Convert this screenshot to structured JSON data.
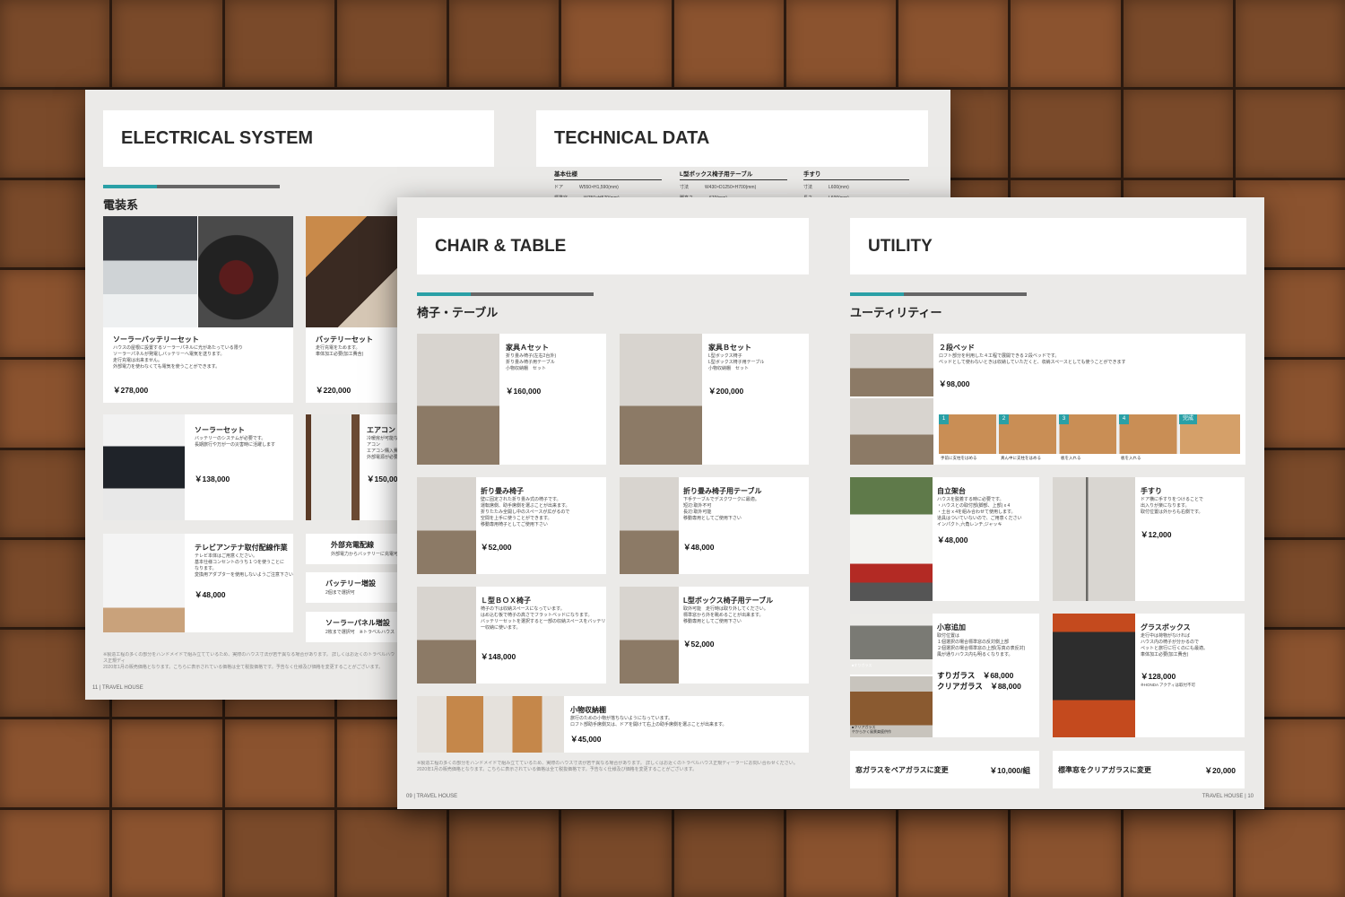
{
  "colors": {
    "accent": "#2aa0a6",
    "page": "#ebeae8",
    "wood": "#6b3f24"
  },
  "back": {
    "electrical": {
      "title": "ELECTRICAL SYSTEM",
      "section": "電装系",
      "items": [
        {
          "name": "ソーラーバッテリーセット",
          "desc": "ハウスの屋根に設置するソーラーパネルに光があたっている限り\nソーラーパネルが発電しバッテリーへ電気を送ります。\n走行充電は出来ません。\n外部電力を使わなくても電気を使うことができます。",
          "price": "￥278,000"
        },
        {
          "name": "バッテリーセット",
          "desc": "走行充電をためます。\n車体加工必要(加工費含)",
          "price": "￥220,000"
        },
        {
          "name": "ソーラーセット",
          "desc": "バッテリーのシステムが必要です。\n長期旅行や万が一の災害時に活躍します",
          "price": "￥138,000"
        },
        {
          "name": "エアコン",
          "desc": "冷暖房が可能なエアコン\nエアコン購入費\n外部電源が必要",
          "price": "￥150,00"
        },
        {
          "name": "テレビアンテナ取付配線作業",
          "desc": "テレビ本体はご用意ください。\n基本仕様コンセントのうち１つを使うことに\nなります。\n変換用アダプターを使用しないようご注意下さい",
          "price": "￥48,000"
        },
        {
          "name": "外部充電配線",
          "desc": "外部電力からバッテリーに充電可能"
        },
        {
          "name": "バッテリー増設",
          "desc": "2個まで選択可"
        },
        {
          "name": "ソーラーパネル増設",
          "desc": "2枚まで選択可　※トラベルハウス"
        }
      ],
      "note": "※製造工程の多くの部分をハンドメイドで組み立てているため、実際のハウス寸法が若干異なる場合があります。 詳しくはお近くのトラベルハウス正規ディ\n2020年1月の販売価格となります。こちらに表示されている価格は全て税抜価格です。予告なく仕様及び価格を変更することがございます。",
      "footer": "11 | TRAVEL HOUSE"
    },
    "technical": {
      "title": "TECHNICAL DATA",
      "columns": [
        {
          "head": "基本仕様",
          "rows": [
            [
              "ドア",
              "W550×H1,590(mm)"
            ],
            [
              "標準窓",
              "W750×H570(mm)"
            ]
          ]
        },
        {
          "head": "L型ボックス椅子用テーブル",
          "rows": [
            [
              "寸法",
              "W430×D1250×H700(mm)"
            ],
            [
              "脚高さ",
              "670(mm)"
            ]
          ]
        },
        {
          "head": "手すり",
          "rows": [
            [
              "寸法",
              "L600(mm)"
            ],
            [
              "長さ",
              "L600(mm)"
            ]
          ]
        }
      ]
    }
  },
  "front": {
    "chair": {
      "title": "CHAIR & TABLE",
      "section": "椅子・テーブル",
      "items": [
        {
          "name": "家具Ａセット",
          "desc": "折り畳み椅子(左右2台外)\n折り畳み椅子用テーブル\n小物収納棚　セット",
          "price": "￥160,000"
        },
        {
          "name": "家具Ｂセット",
          "desc": "L型ボックス椅子\nL型ボックス椅子用テーブル\n小物収納棚　セット",
          "price": "￥200,000"
        },
        {
          "name": "折り畳み椅子",
          "desc": "壁に固定された折り畳み式の椅子です。\n運転席側、助手席側を選ぶことが出来ます。\n折りたたみ全開し中のスペースが広がるので\n空間を上手に使うことができます。\n移動専用椅子としてご使用下さい",
          "price": "￥52,000"
        },
        {
          "name": "折り畳み椅子用テーブル",
          "desc": "下手テーブルでデスクワークに最適。\n短辺:取外不可\n長辺:取外可能\n移動専用としてご使用下さい",
          "price": "￥48,000"
        },
        {
          "name": "Ｌ型ＢＯＸ椅子",
          "desc": "椅子の下は収納スペースになっています。\nはめ込む板で椅子の高さでフラットベッドになります。\nバッテリーセットを選択すると一部の収納スペースをバッテリ\n一収納に使います。",
          "price": "￥148,000"
        },
        {
          "name": "L型ボックス椅子用テーブル",
          "desc": "取外可能　走行時は取り外してください。\n標準窓から外を眺めることが出来ます。\n移動専用としてご使用下さい",
          "price": "￥52,000"
        },
        {
          "name": "小物収納棚",
          "desc": "旅行のための小物が落ちないようになっています。\nロフト部助手席側又は、ドアを開けて右上の助手席側を選ぶことが出来ます。",
          "price": "￥45,000"
        }
      ],
      "note": "※製造工程の多くの部分をハンドメイドで組み立てているため、実際のハウス寸法が若干異なる場合があります。 詳しくはお近くのトラベルハウス正規ディーラーにお問い合わせください。\n2020年1月の販売価格となります。こちらに表示されている価格は全て税抜価格です。予告なく仕様及び価格を変更することがございます。",
      "footer": "09 | TRAVEL HOUSE"
    },
    "utility": {
      "title": "UTILITY",
      "section": "ユーティリティー",
      "items": [
        {
          "name": "２段ベッド",
          "desc": "ロフト部分を利用した４工程で展開できる２段ベッドです。\nベッドとして使わないときは収納していただくと、収納スペースとしても使うことができます",
          "price": "￥98,000"
        },
        {
          "name": "自立架台",
          "desc": "ハウスを脱着する時に必要です。\n・ハウスとの取付部(脚部、上部) x 4\n・土台 x 4を組み合わせて使用します。\n道具はついていないので、ご用意ください\nインパクト,六角レンチ,ジャッキ",
          "price": "￥48,000"
        },
        {
          "name": "手すり",
          "desc": "ドア横に手すりをつけることで\n出入りが楽になります。\n取付位置は外からも右側です。",
          "price": "￥12,000"
        },
        {
          "name": "小窓追加",
          "desc": "取付位置は\n１個選択の場合標準窓の反対側上部\n２個選択の場合標準窓の上部(写真の表反対)\n風が通りハウス内も明るくなります。",
          "price": "すりガラス　￥68,000",
          "price2": "クリアガラス　￥88,000"
        },
        {
          "name": "グラスボックス",
          "desc": "走行中は荷物がなければ\nハウス内の椅子が分かるので\nペットと旅行に行くのにも最適。\n車体加工必要(加工費含)",
          "price": "￥128,000",
          "sub": "※HONDA アクティは取付不可"
        }
      ],
      "steps": [
        {
          "n": "1",
          "label": "手前に支柱をはめる"
        },
        {
          "n": "2",
          "label": "真ん中に支柱をはめる"
        },
        {
          "n": "3",
          "label": "板を入れる"
        },
        {
          "n": "4",
          "label": "板を入れる"
        },
        {
          "n": "完成",
          "label": ""
        }
      ],
      "options": [
        {
          "label": "窓ガラスをペアガラスに変更",
          "price": "￥10,000/組"
        },
        {
          "label": "標準窓をクリアガラスに変更",
          "price": "￥20,000"
        }
      ],
      "photo_caption": "■クリアガラス\nやからかく風景楽疲供作",
      "photo_caption2": "■すりガラス",
      "footer": "TRAVEL HOUSE | 10"
    }
  }
}
